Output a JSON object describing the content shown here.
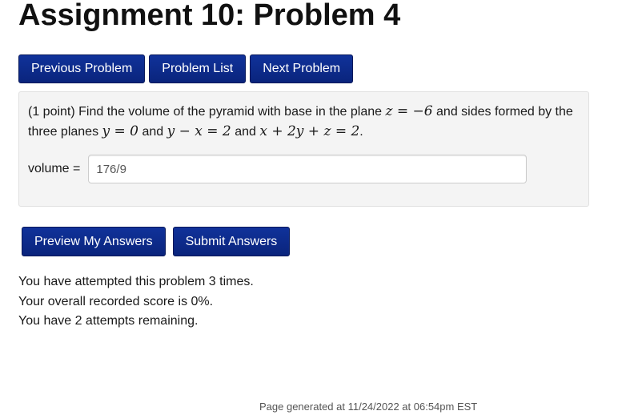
{
  "page": {
    "title": "Assignment 10: Problem 4"
  },
  "nav": {
    "previous_label": "Previous Problem",
    "list_label": "Problem List",
    "next_label": "Next Problem"
  },
  "problem": {
    "points": "(1 point)",
    "text_part1": "Find the volume of the pyramid with base in the plane",
    "math_base_plane": "z = −6",
    "text_part2": "and sides formed by the three planes",
    "math_plane1": "y = 0",
    "text_and1": "and",
    "math_plane2": "y − x = 2",
    "text_and2": "and",
    "math_plane3": "x + 2y + z = 2",
    "text_end": ".",
    "answer_label": "volume =",
    "answer_value": "176/9"
  },
  "actions": {
    "preview_label": "Preview My Answers",
    "submit_label": "Submit Answers"
  },
  "status": {
    "attempts": "You have attempted this problem 3 times.",
    "score": "Your overall recorded score is 0%.",
    "remaining": "You have 2 attempts remaining."
  },
  "footer": {
    "generated": "Page generated at 11/24/2022 at 06:54pm EST"
  },
  "colors": {
    "button_bg": "#0a2a8c",
    "button_text": "#ffffff",
    "problem_bg": "#f4f4f4"
  }
}
